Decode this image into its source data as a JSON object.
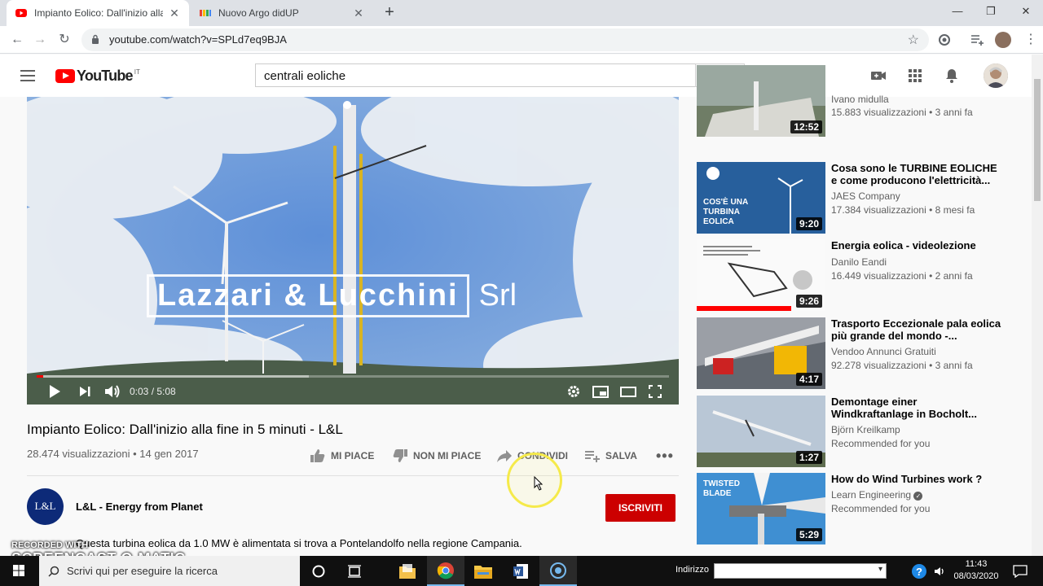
{
  "browser": {
    "tabs": [
      {
        "title": "Impianto Eolico: Dall'inizio alla fine",
        "active": true
      },
      {
        "title": "Nuovo Argo didUP",
        "active": false
      }
    ],
    "url": "youtube.com/watch?v=SPLd7eq9BJA"
  },
  "youtube": {
    "logo_text": "YouTube",
    "country": "IT",
    "search_query": "centrali eoliche"
  },
  "player": {
    "overlay_brand": "Lazzari & Lucchini",
    "overlay_suffix": "Srl",
    "current_time": "0:03",
    "duration": "5:08",
    "time_separator": " / ",
    "played_fraction": 0.01,
    "buffered_fraction": 0.43
  },
  "video": {
    "title": "Impianto Eolico: Dall'inizio alla fine in 5 minuti - L&L",
    "views": "28.474 visualizzazioni",
    "date": "14 gen 2017",
    "like_label": "MI PIACE",
    "dislike_label": "NON MI PIACE",
    "share_label": "CONDIVIDI",
    "save_label": "SALVA",
    "channel_initials": "L&L",
    "channel_name": "L&L - Energy from Planet",
    "subscribe_label": "ISCRIVITI",
    "description": "Questa turbina eolica da 1.0 MW è alimentata si trova a Pontelandolfo nella regione Campania."
  },
  "recommendations": [
    {
      "title": "",
      "channel": "Ivano midulla",
      "meta": "15.883 visualizzazioni • 3 anni fa",
      "duration": "12:52"
    },
    {
      "title": "Cosa sono le TURBINE EOLICHE e come producono l'elettricità...",
      "channel": "JAES Company",
      "meta": "17.384 visualizzazioni • 8 mesi fa",
      "duration": "9:20",
      "thumb_text": "COS'È UNA TURBINA EOLICA"
    },
    {
      "title": "Energia eolica - videolezione",
      "channel": "Danilo Eandi",
      "meta": "16.449 visualizzazioni • 2 anni fa",
      "duration": "9:26"
    },
    {
      "title": "Trasporto Eccezionale pala eolica più grande del mondo -...",
      "channel": "Vendoo Annunci Gratuiti",
      "meta": "92.278 visualizzazioni • 3 anni fa",
      "duration": "4:17"
    },
    {
      "title": "Demontage einer Windkraftanlage in Bocholt...",
      "channel": "Björn Kreilkamp",
      "meta": "Recommended for you",
      "duration": "1:27"
    },
    {
      "title": "How do Wind Turbines work ?",
      "channel": "Learn Engineering",
      "meta": "Recommended for you",
      "duration": "5:29",
      "thumb_text": "TWISTED BLADE"
    }
  ],
  "watermark": {
    "recorded_with": "RECORDED WITH",
    "brand": "SCREENCAST-O-MATIC"
  },
  "taskbar": {
    "search_placeholder": "Scrivi qui per eseguire la ricerca",
    "address_label": "Indirizzo",
    "time": "11:43",
    "date": "08/03/2020"
  },
  "colors": {
    "yt_red": "#ff0000",
    "subscribe": "#cc0000",
    "cursor_highlight": "#f5ea4a"
  }
}
